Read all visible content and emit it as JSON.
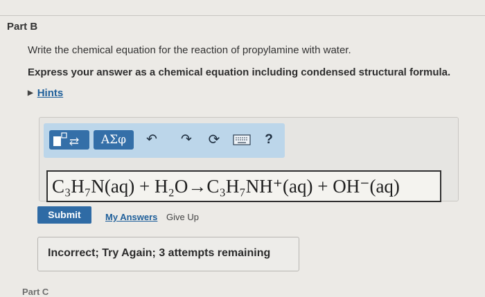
{
  "part": {
    "title": "Part B"
  },
  "question": {
    "prompt": "Write the chemical equation for the reaction of propylamine with water.",
    "instruction": "Express your answer as a chemical equation including condensed structural formula.",
    "hints_label": "Hints"
  },
  "toolbar": {
    "greek_label": "ΑΣφ",
    "help_label": "?",
    "icons": [
      "templates-icon",
      "undo-icon",
      "redo-icon",
      "reset-icon",
      "keyboard-icon",
      "help-icon"
    ]
  },
  "answer": {
    "equation": "C₃H₇N(aq) + H₂O→C₃H₇NH⁺(aq) + OH⁻(aq)"
  },
  "actions": {
    "submit_label": "Submit",
    "my_answers_label": "My Answers",
    "give_up_label": "Give Up"
  },
  "feedback": {
    "message": "Incorrect; Try Again; 3 attempts remaining"
  },
  "next_part": {
    "title": "Part C"
  },
  "colors": {
    "accent": "#2f6ba5",
    "toolbar_bg": "#bcd6ea",
    "link": "#1f5f9a"
  }
}
